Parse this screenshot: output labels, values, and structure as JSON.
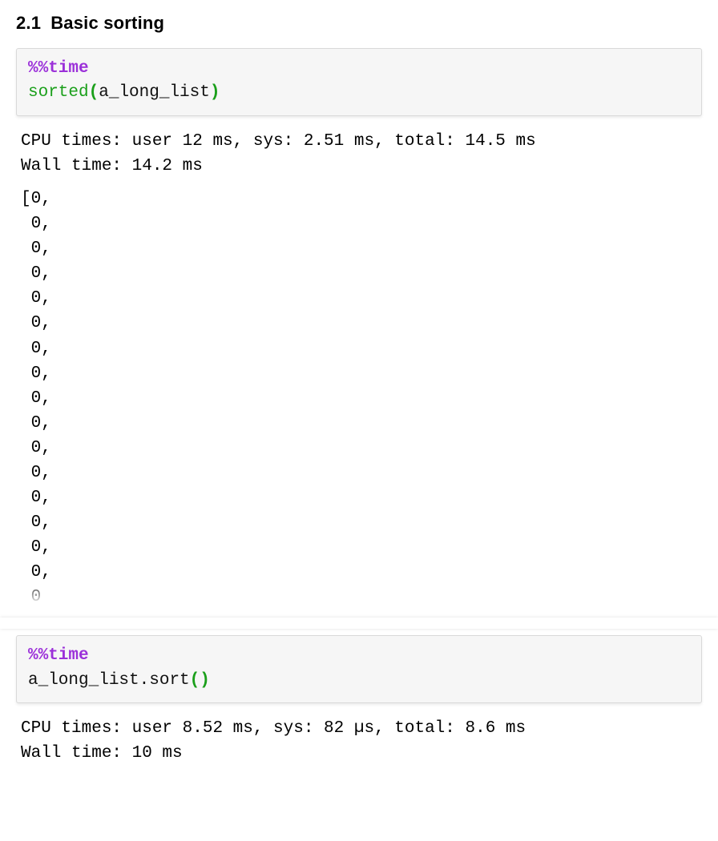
{
  "heading": {
    "number": "2.1",
    "title": "Basic sorting"
  },
  "cell1": {
    "code": {
      "magic": "%%time",
      "func": "sorted",
      "open": "(",
      "arg": "a_long_list",
      "close": ")"
    },
    "timing_line1": "CPU times: user 12 ms, sys: 2.51 ms, total: 14.5 ms",
    "timing_line2": "Wall time: 14.2 ms",
    "result_preview": "[0,\n 0,\n 0,\n 0,\n 0,\n 0,\n 0,\n 0,\n 0,\n 0,\n 0,\n 0,\n 0,\n 0,\n 0,\n 0,\n 0"
  },
  "cell2": {
    "code": {
      "magic": "%%time",
      "obj": "a_long_list",
      "dot": ".",
      "method": "sort",
      "open": "(",
      "close": ")"
    },
    "timing_line1": "CPU times: user 8.52 ms, sys: 82 µs, total: 8.6 ms",
    "timing_line2": "Wall time: 10 ms"
  }
}
